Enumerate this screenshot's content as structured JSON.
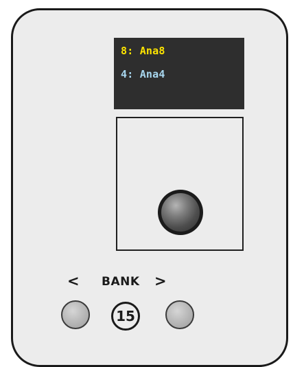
{
  "display": {
    "line1": {
      "text": "8: Ana8",
      "color": "#ffe500"
    },
    "line2": {
      "text": "4: Ana4",
      "color": "#a9d8f0"
    }
  },
  "bank": {
    "prev_label": "<",
    "title": "BANK",
    "next_label": ">",
    "number": "15"
  },
  "icons": {
    "joystick": "joystick-knob-icon",
    "prev_button": "round-push-button",
    "next_button": "round-push-button"
  }
}
